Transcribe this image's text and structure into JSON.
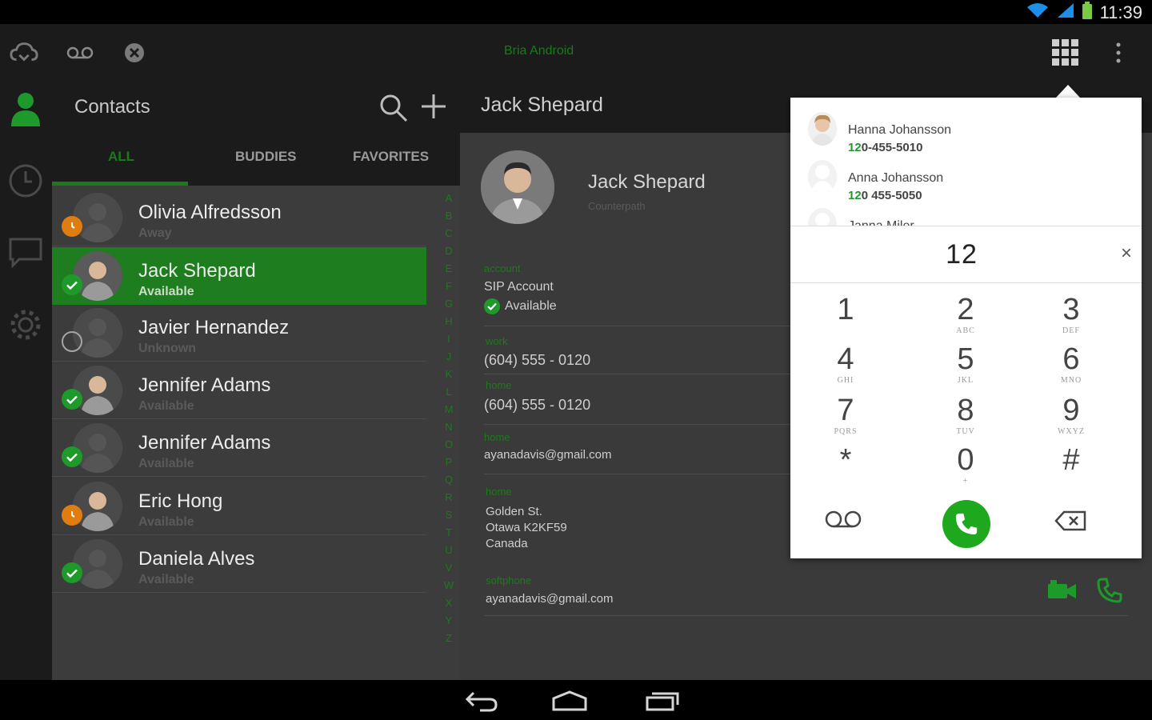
{
  "status_bar": {
    "time": "11:39"
  },
  "app": {
    "title": "Bria Android"
  },
  "contacts": {
    "title": "Contacts",
    "tabs": [
      "ALL",
      "BUDDIES",
      "FAVORITES"
    ],
    "alphabet": [
      "A",
      "B",
      "C",
      "D",
      "E",
      "F",
      "G",
      "H",
      "I",
      "J",
      "K",
      "L",
      "M",
      "N",
      "O",
      "P",
      "Q",
      "R",
      "S",
      "T",
      "U",
      "V",
      "W",
      "X",
      "Y",
      "Z"
    ],
    "rows": [
      {
        "name": "Olivia Alfredsson",
        "status": "Away",
        "presence": "away"
      },
      {
        "name": "Jack Shepard",
        "status": "Available",
        "presence": "ok"
      },
      {
        "name": "Javier Hernandez",
        "status": "Unknown",
        "presence": "unknown"
      },
      {
        "name": "Jennifer Adams",
        "status": "Available",
        "presence": "ok"
      },
      {
        "name": "Jennifer Adams",
        "status": "Available",
        "presence": "ok"
      },
      {
        "name": "Eric Hong",
        "status": "Available",
        "presence": "away"
      },
      {
        "name": "Daniela Alves",
        "status": "Available",
        "presence": "ok"
      }
    ]
  },
  "details": {
    "header_title": "Jack Shepard",
    "name": "Jack Shepard",
    "company": "Counterpath",
    "account_label": "account",
    "account_value": "SIP Account",
    "account_status": "Available",
    "work_label": "work",
    "work_value": "(604) 555 - 0120",
    "home_phone_label": "home",
    "home_phone_value": "(604) 555 - 0120",
    "home_email_label": "home",
    "home_email_value": "ayanadavis@gmail.com",
    "home_address_label": "home",
    "address_line1": "Golden St.",
    "address_line2": "Otawa K2KF59",
    "address_line3": "Canada",
    "softphone_label": "softphone",
    "softphone_value": "ayanadavis@gmail.com"
  },
  "dialer": {
    "suggestions": [
      {
        "name": "Hanna Johansson",
        "match": "12",
        "rest": "0-455-5010"
      },
      {
        "name": "Anna Johansson",
        "match": "12",
        "rest": "0 455-5050"
      },
      {
        "name": "Janna Miler",
        "match": "",
        "rest": ""
      }
    ],
    "number": "12",
    "clear": "×",
    "keys": [
      {
        "digit": "1",
        "letters": ""
      },
      {
        "digit": "2",
        "letters": "ABC"
      },
      {
        "digit": "3",
        "letters": "DEF"
      },
      {
        "digit": "4",
        "letters": "GHI"
      },
      {
        "digit": "5",
        "letters": "JKL"
      },
      {
        "digit": "6",
        "letters": "MNO"
      },
      {
        "digit": "7",
        "letters": "PQRS"
      },
      {
        "digit": "8",
        "letters": "TUV"
      },
      {
        "digit": "9",
        "letters": "WXYZ"
      },
      {
        "digit": "*",
        "letters": ""
      },
      {
        "digit": "0",
        "letters": "+"
      },
      {
        "digit": "#",
        "letters": ""
      }
    ]
  }
}
